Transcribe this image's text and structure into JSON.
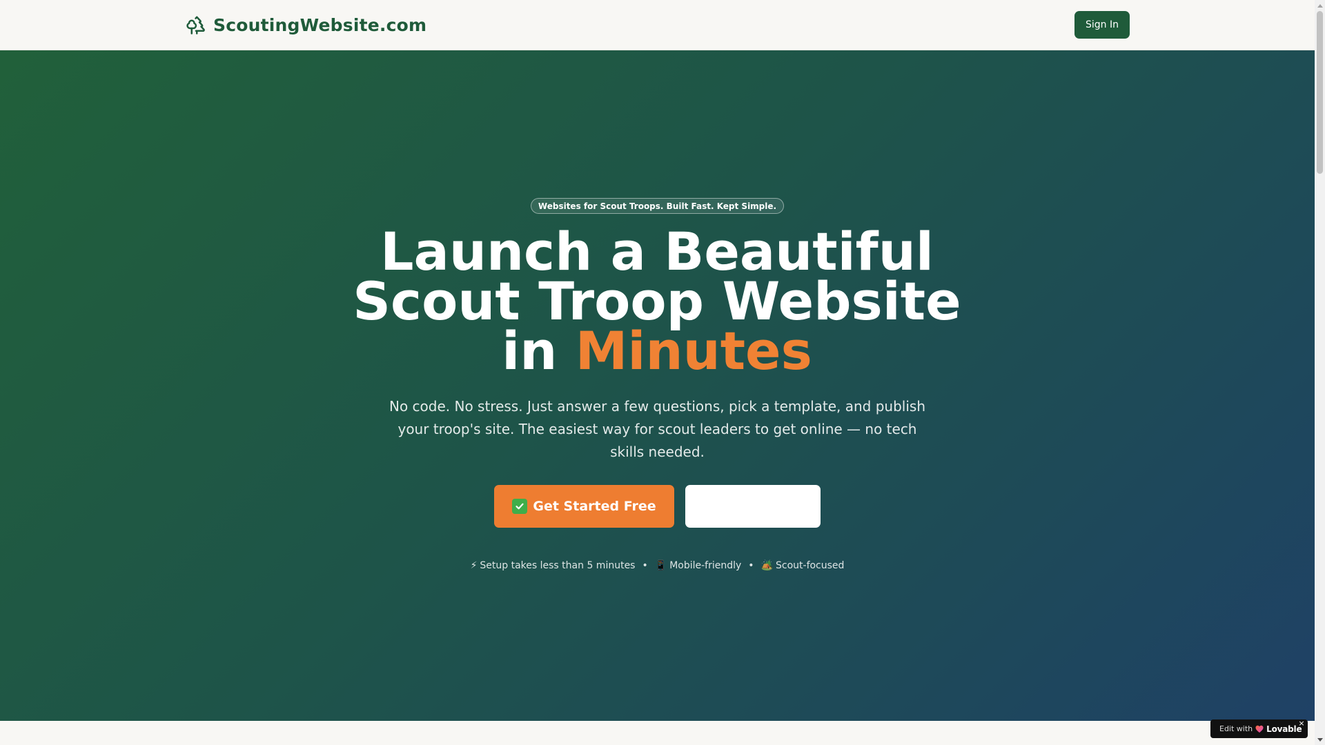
{
  "header": {
    "brand_name": "ScoutingWebsite.com",
    "signin_label": "Sign In"
  },
  "hero": {
    "badge": "Websites for Scout Troops. Built Fast. Kept Simple.",
    "headline_line1": "Launch a Beautiful",
    "headline_line2": "Scout Troop Website",
    "headline_in": "in ",
    "headline_accent": "Minutes",
    "subtext": "No code. No stress. Just answer a few questions, pick a template, and publish your troop's site. The easiest way for scout leaders to get online — no tech skills needed.",
    "cta_primary": "Get Started Free",
    "cta_secondary": "",
    "features": [
      {
        "glyph": "⚡",
        "label": "Setup takes less than 5 minutes"
      },
      {
        "glyph": "📱",
        "label": "Mobile-friendly"
      },
      {
        "glyph": "🏕️",
        "label": "Scout-focused"
      }
    ],
    "separator": "•"
  },
  "lovable": {
    "prefix": "Edit with",
    "brand": "Lovable",
    "close": "×"
  },
  "colors": {
    "brand_green": "#1f5b3a",
    "accent_orange": "#ee7d31",
    "gradient_start": "#21603a",
    "gradient_end": "#1f4166"
  }
}
